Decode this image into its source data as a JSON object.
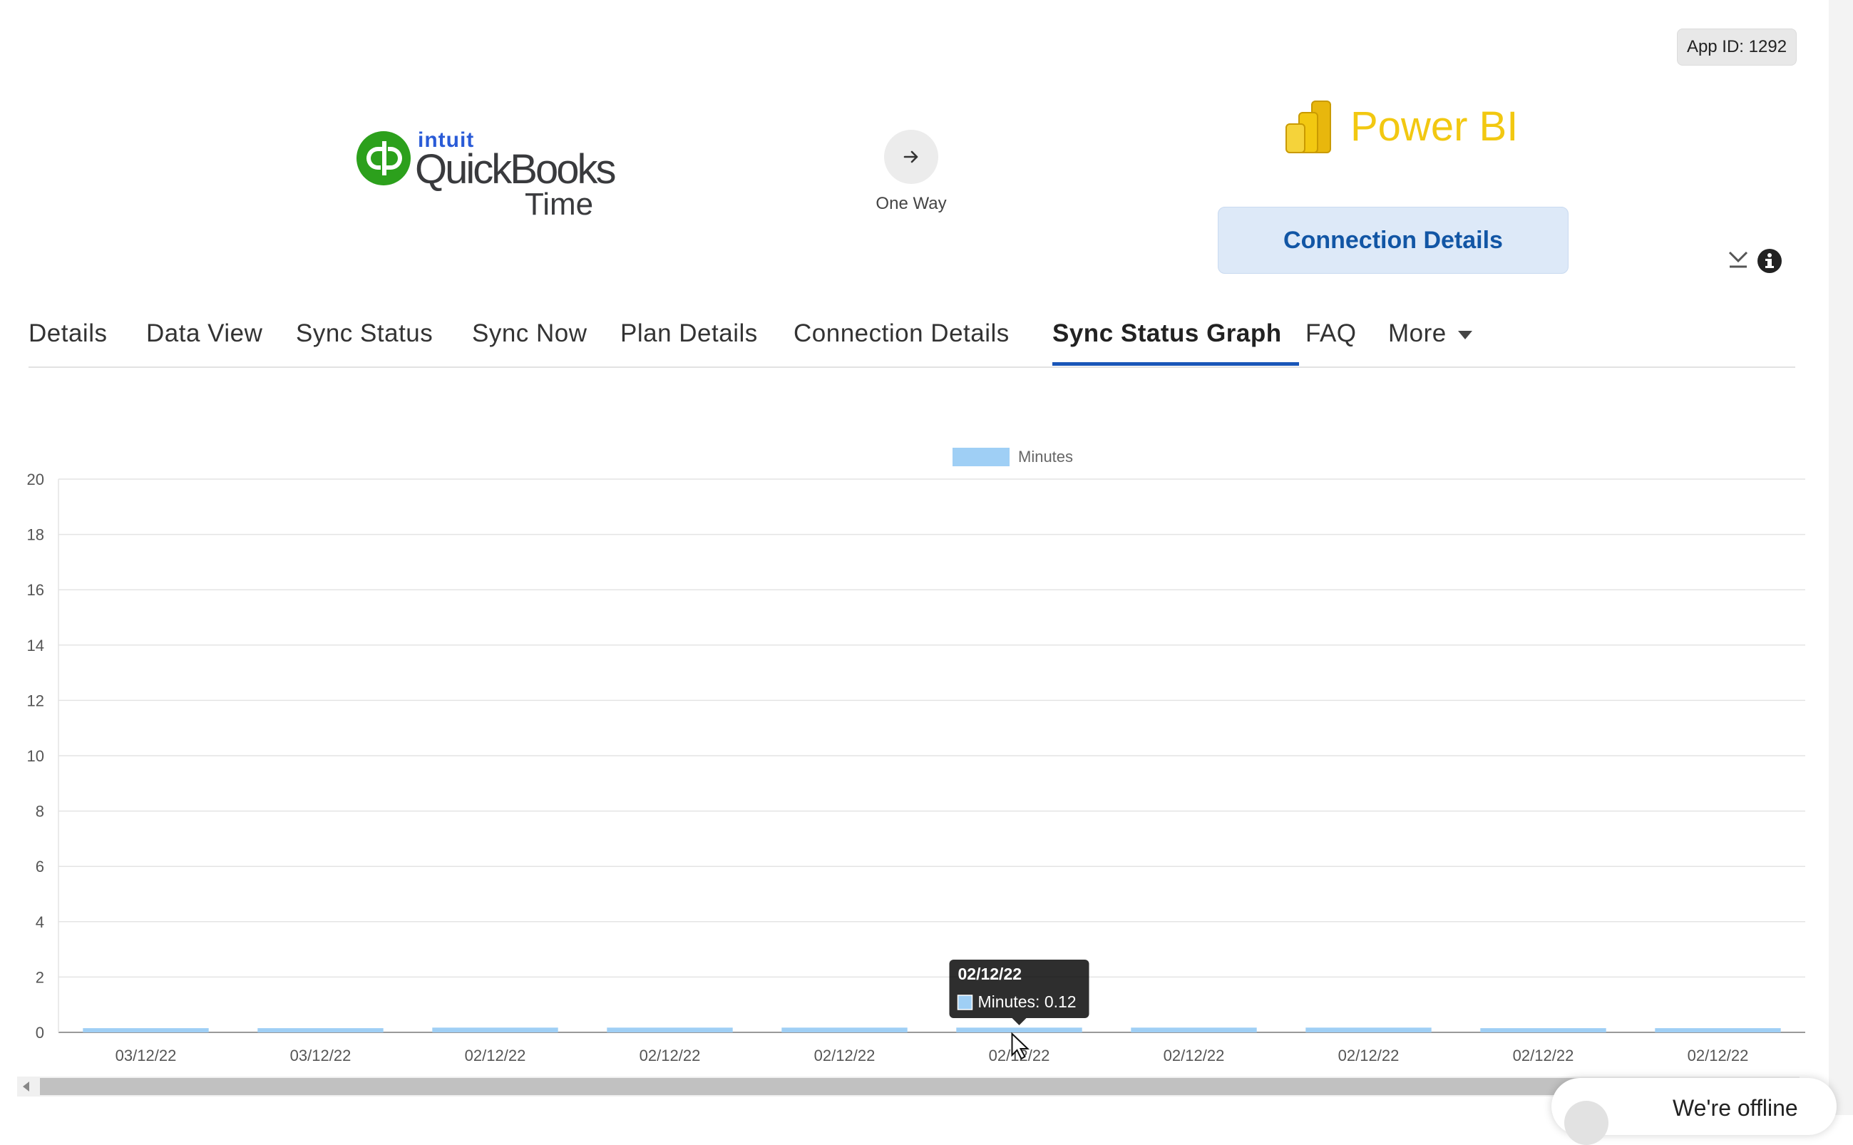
{
  "header": {
    "app_id": "App ID: 1292",
    "source_app": {
      "brand": "intuit",
      "name": "QuickBooks",
      "suffix": "Time",
      "color": "#2ca01c"
    },
    "direction": {
      "label": "One Way",
      "icon": "arrow-right-icon"
    },
    "target_app": {
      "name": "Power BI",
      "color": "#f2c811"
    },
    "connection_details_button": "Connection Details"
  },
  "tabs": [
    {
      "label": "Details"
    },
    {
      "label": "Data View"
    },
    {
      "label": "Sync Status"
    },
    {
      "label": "Sync Now"
    },
    {
      "label": "Plan Details"
    },
    {
      "label": "Connection Details"
    },
    {
      "label": "Sync Status Graph",
      "active": true
    },
    {
      "label": "FAQ"
    },
    {
      "label": "More"
    }
  ],
  "chart_data": {
    "type": "bar",
    "legend": "Minutes",
    "legend_position": "top-center",
    "grid": true,
    "categories": [
      "03/12/22",
      "03/12/22",
      "02/12/22",
      "02/12/22",
      "02/12/22",
      "02/12/22",
      "02/12/22",
      "02/12/22",
      "02/12/22",
      "02/12/22"
    ],
    "series": [
      {
        "name": "Minutes",
        "values": [
          0.1,
          0.1,
          0.12,
          0.12,
          0.12,
          0.12,
          0.12,
          0.12,
          0.1,
          0.1
        ]
      }
    ],
    "ylim": [
      0,
      20
    ],
    "yticks": [
      0,
      2,
      4,
      6,
      8,
      10,
      12,
      14,
      16,
      18,
      20
    ],
    "bar_color": "#9fcff5",
    "tooltip": {
      "title": "02/12/22",
      "label": "Minutes: 0.12",
      "index": 5
    }
  },
  "chat_widget": {
    "status": "We're offline"
  }
}
